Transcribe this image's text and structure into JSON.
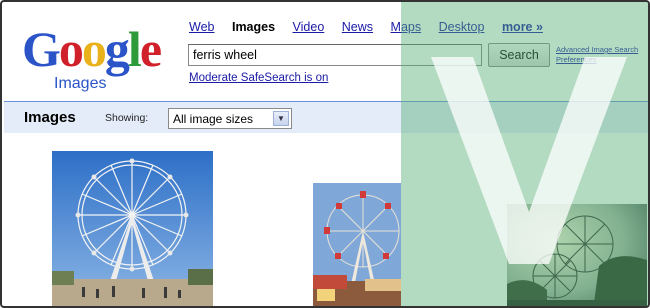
{
  "logo": {
    "text": "Google",
    "sub": "Images"
  },
  "nav": {
    "items": [
      {
        "label": "Web",
        "active": false
      },
      {
        "label": "Images",
        "active": true
      },
      {
        "label": "Video",
        "active": false
      },
      {
        "label": "News",
        "active": false
      },
      {
        "label": "Maps",
        "active": false
      },
      {
        "label": "Desktop",
        "active": false
      },
      {
        "label": "more »",
        "active": false
      }
    ]
  },
  "search": {
    "value": "ferris wheel",
    "button_label": "Search",
    "advanced_label": "Advanced Image Search",
    "preferences_label": "Preferences",
    "safesearch_label": "Moderate SafeSearch is on"
  },
  "bar": {
    "title": "Images",
    "showing_label": "Showing:",
    "size_value": "All image sizes"
  },
  "colors": {
    "link": "#1a1aa6",
    "bar_bg": "#e5ecf9",
    "watermark": "#56b078"
  }
}
